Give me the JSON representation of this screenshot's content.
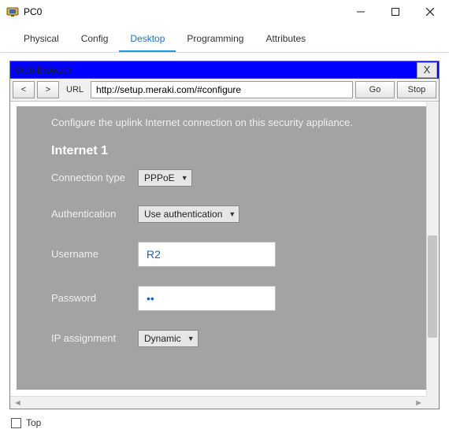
{
  "window": {
    "title": "PC0",
    "tabs": [
      "Physical",
      "Config",
      "Desktop",
      "Programming",
      "Attributes"
    ],
    "active_tab": "Desktop",
    "top_checkbox_label": "Top",
    "top_checked": false
  },
  "browser": {
    "title": "Web Browser",
    "back_label": "<",
    "forward_label": ">",
    "url_label": "URL",
    "url_value": "http://setup.meraki.com/#configure",
    "go_label": "Go",
    "stop_label": "Stop",
    "close_label": "X"
  },
  "page": {
    "description": "Configure the uplink Internet connection on this security appliance.",
    "section_heading": "Internet 1",
    "fields": {
      "connection_type": {
        "label": "Connection type",
        "value": "PPPoE"
      },
      "authentication": {
        "label": "Authentication",
        "value": "Use authentication"
      },
      "username": {
        "label": "Username",
        "value": "R2"
      },
      "password": {
        "label": "Password",
        "value": "••"
      },
      "ip_assignment": {
        "label": "IP assignment",
        "value": "Dynamic"
      }
    }
  }
}
